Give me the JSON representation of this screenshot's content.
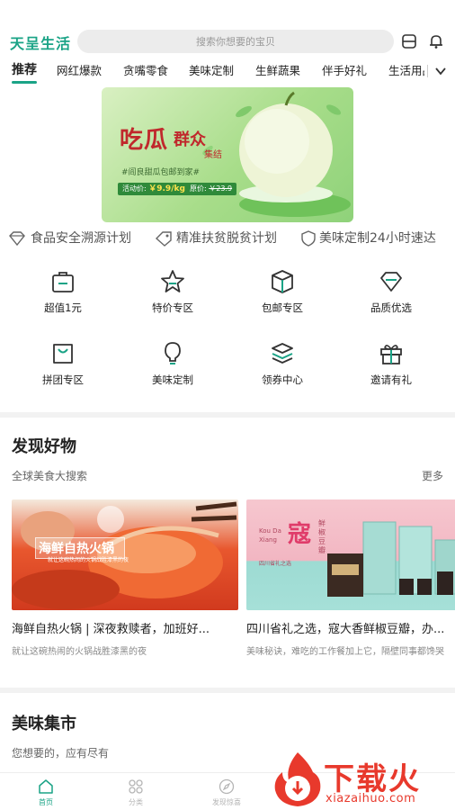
{
  "header": {
    "logo": "天呈生活",
    "search_placeholder": "搜索你想要的宝贝",
    "icons": [
      "scan-icon",
      "bell-icon"
    ]
  },
  "tabs": [
    "推荐",
    "网红爆款",
    "贪嘴零食",
    "美味定制",
    "生鲜蔬果",
    "伴手好礼",
    "生活用品"
  ],
  "banner": {
    "title_main": "吃瓜",
    "title_side": "群众",
    "title_sub": "集结",
    "hashtag": "#阎良甜瓜包邮到家#",
    "price_label": "活动价",
    "price_value": "￥9.9/kg",
    "orig_label": "原价",
    "orig_value": "￥23.9"
  },
  "slogans": [
    {
      "icon": "diamond-icon",
      "text": "食品安全溯源计划"
    },
    {
      "icon": "tag-icon",
      "text": "精准扶贫脱贫计划"
    },
    {
      "icon": "shield-icon",
      "text": "美味定制24小时速达"
    }
  ],
  "categories": [
    {
      "icon": "bag-icon",
      "label": "超值1元"
    },
    {
      "icon": "star-icon",
      "label": "特价专区"
    },
    {
      "icon": "box-icon",
      "label": "包邮专区"
    },
    {
      "icon": "gem-icon",
      "label": "品质优选"
    },
    {
      "icon": "group-bag-icon",
      "label": "拼团专区"
    },
    {
      "icon": "bulb-icon",
      "label": "美味定制"
    },
    {
      "icon": "coupon-stack-icon",
      "label": "领券中心"
    },
    {
      "icon": "gift-icon",
      "label": "邀请有礼"
    }
  ],
  "discover": {
    "title": "发现好物",
    "subtitle": "全球美食大搜索",
    "more": "更多",
    "cards": [
      {
        "img_text": "海鲜自热火锅",
        "img_sub": "就让这碗热闹的火锅战胜漆黑的夜",
        "title": "海鲜自热火锅 | 深夜救赎者，加班好...",
        "desc": "就让这碗热闹的火锅战胜漆黑的夜"
      },
      {
        "img_text": "寇",
        "img_pinyin": "Kou Da Xiang",
        "img_sub": "四川省礼之选",
        "img_label": "鲜椒豆瓣",
        "title": "四川省礼之选，寇大香鲜椒豆瓣，办...",
        "desc": "美味秘诀，难吃的工作餐加上它，隔壁同事都馋哭"
      }
    ]
  },
  "market": {
    "title": "美味集市",
    "subtitle": "您想要的，应有尽有"
  },
  "bottom_nav": [
    {
      "icon": "home-icon",
      "label": "首页",
      "active": true
    },
    {
      "icon": "category-icon",
      "label": "分类",
      "active": false
    },
    {
      "icon": "compass-icon",
      "label": "发现惊喜",
      "active": false
    }
  ],
  "watermark": {
    "main": "下载火",
    "sub": "xiazaihuo.com"
  },
  "colors": {
    "accent": "#1aa386",
    "banner_red": "#c0282c",
    "watermark": "#e8392c"
  }
}
